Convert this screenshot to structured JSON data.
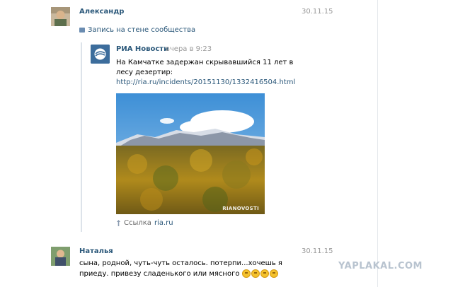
{
  "posts": [
    {
      "author": "Александр",
      "date": "30.11.15",
      "repost_label": "Запись на стене сообщества",
      "repost": {
        "source_name": "РИА Новости",
        "source_time": "вчера в 9:23",
        "text": "На Камчатке задержан скрывавшийся 11 лет в лесу дезертир:",
        "link": "http://ria.ru/incidents/20151130/1332416504.html",
        "photo_watermark": "RIANOVOSTI",
        "link_caption_label": "Ссылка",
        "link_caption_domain": "ria.ru"
      }
    },
    {
      "author": "Наталья",
      "date": "30.11.15",
      "text": "сына, родной, чуть-чуть осталось. потерпи...хочешь я приеду. привезу сладенького или мясного"
    }
  ],
  "site_watermark": "YAPLAKAL.COM",
  "colors": {
    "link": "#2b587a",
    "meta": "#999999",
    "divider": "#e5e8ec"
  },
  "icons": {
    "repost": "repost-icon",
    "link_attachment": "pin-icon",
    "emoji": "smile-emoji-icon"
  }
}
